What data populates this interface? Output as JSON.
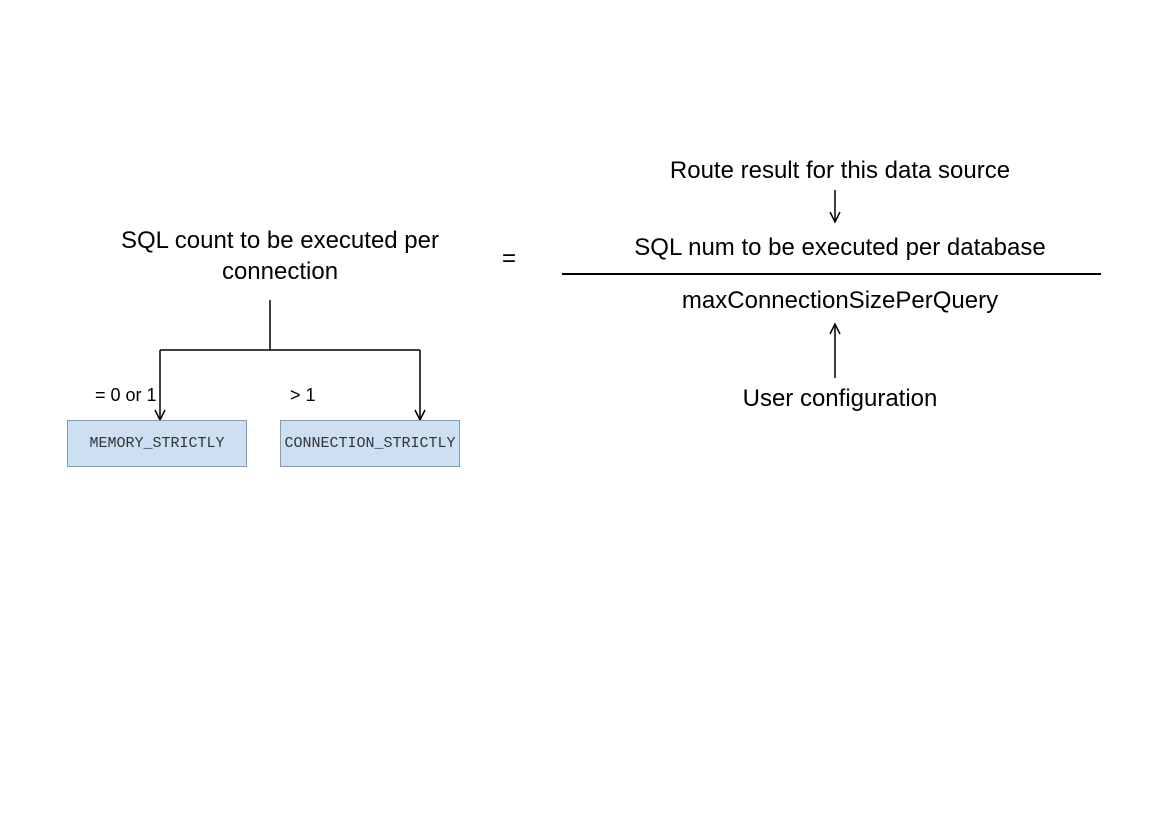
{
  "leftHeading": "SQL count to be executed per connection",
  "conditionLeft": "= 0 or 1",
  "conditionRight": "> 1",
  "modeLeft": "MEMORY_STRICTLY",
  "modeRight": "CONNECTION_STRICTLY",
  "equals": "=",
  "topLabel": "Route result for this data source",
  "numerator": "SQL num to be executed per database",
  "denominator": "maxConnectionSizePerQuery",
  "bottomLabel": "User configuration"
}
